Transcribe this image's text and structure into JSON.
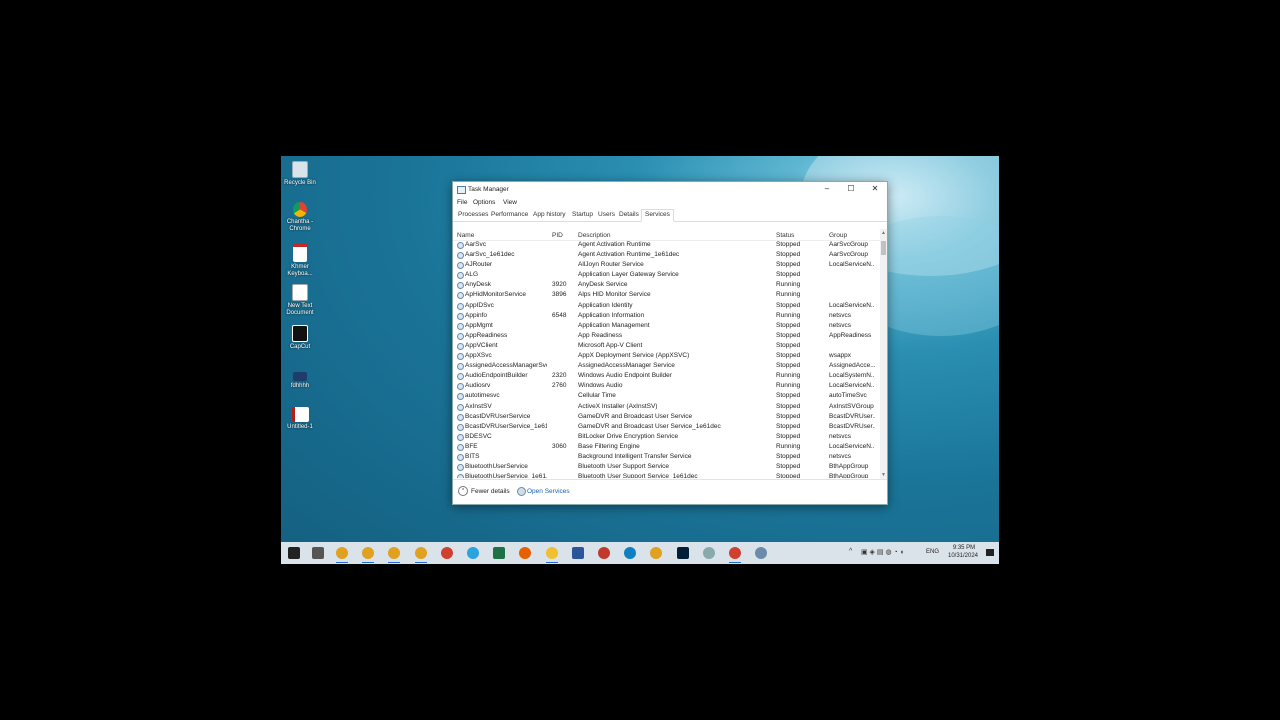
{
  "desktop": {
    "icons": [
      {
        "label": "Recycle Bin",
        "icon": "recycle-bin-icon"
      },
      {
        "label": "Chantha - Chrome",
        "icon": "chrome-icon"
      },
      {
        "label": "Khmer Keyboa...",
        "icon": "pdf-icon"
      },
      {
        "label": "New Text Document",
        "icon": "text-document-icon"
      },
      {
        "label": "CapCut",
        "icon": "capcut-icon"
      },
      {
        "label": "fdhhhh",
        "icon": "shortcut-icon"
      },
      {
        "label": "Untitled-1",
        "icon": "document-icon"
      }
    ]
  },
  "window": {
    "title": "Task Manager",
    "menu": [
      "File",
      "Options",
      "View"
    ],
    "tabs": [
      "Processes",
      "Performance",
      "App history",
      "Startup",
      "Users",
      "Details",
      "Services"
    ],
    "active_tab": "Services"
  },
  "table": {
    "columns": [
      "Name",
      "PID",
      "Description",
      "Status",
      "Group"
    ],
    "rows": [
      [
        "AarSvc",
        "",
        "Agent Activation Runtime",
        "Stopped",
        "AarSvcGroup"
      ],
      [
        "AarSvc_1e61dec",
        "",
        "Agent Activation Runtime_1e61dec",
        "Stopped",
        "AarSvcGroup"
      ],
      [
        "AJRouter",
        "",
        "AllJoyn Router Service",
        "Stopped",
        "LocalServiceN..."
      ],
      [
        "ALG",
        "",
        "Application Layer Gateway Service",
        "Stopped",
        ""
      ],
      [
        "AnyDesk",
        "3920",
        "AnyDesk Service",
        "Running",
        ""
      ],
      [
        "ApHidMonitorService",
        "3896",
        "Alps HID Monitor Service",
        "Running",
        ""
      ],
      [
        "AppIDSvc",
        "",
        "Application Identity",
        "Stopped",
        "LocalServiceN..."
      ],
      [
        "Appinfo",
        "6548",
        "Application Information",
        "Running",
        "netsvcs"
      ],
      [
        "AppMgmt",
        "",
        "Application Management",
        "Stopped",
        "netsvcs"
      ],
      [
        "AppReadiness",
        "",
        "App Readiness",
        "Stopped",
        "AppReadiness"
      ],
      [
        "AppVClient",
        "",
        "Microsoft App-V Client",
        "Stopped",
        ""
      ],
      [
        "AppXSvc",
        "",
        "AppX Deployment Service (AppXSVC)",
        "Stopped",
        "wsappx"
      ],
      [
        "AssignedAccessManagerSvc",
        "",
        "AssignedAccessManager Service",
        "Stopped",
        "AssignedAcce..."
      ],
      [
        "AudioEndpointBuilder",
        "2320",
        "Windows Audio Endpoint Builder",
        "Running",
        "LocalSystemN..."
      ],
      [
        "Audiosrv",
        "2760",
        "Windows Audio",
        "Running",
        "LocalServiceN..."
      ],
      [
        "autotimesvc",
        "",
        "Cellular Time",
        "Stopped",
        "autoTimeSvc"
      ],
      [
        "AxInstSV",
        "",
        "ActiveX Installer (AxInstSV)",
        "Stopped",
        "AxInstSVGroup"
      ],
      [
        "BcastDVRUserService",
        "",
        "GameDVR and Broadcast User Service",
        "Stopped",
        "BcastDVRUser..."
      ],
      [
        "BcastDVRUserService_1e61...",
        "",
        "GameDVR and Broadcast User Service_1e61dec",
        "Stopped",
        "BcastDVRUser..."
      ],
      [
        "BDESVC",
        "",
        "BitLocker Drive Encryption Service",
        "Stopped",
        "netsvcs"
      ],
      [
        "BFE",
        "3060",
        "Base Filtering Engine",
        "Running",
        "LocalServiceN..."
      ],
      [
        "BITS",
        "",
        "Background Intelligent Transfer Service",
        "Stopped",
        "netsvcs"
      ],
      [
        "BluetoothUserService",
        "",
        "Bluetooth User Support Service",
        "Stopped",
        "BthAppGroup"
      ],
      [
        "BluetoothUserService_1e61...",
        "",
        "Bluetooth User Support Service_1e61dec",
        "Stopped",
        "BthAppGroup"
      ]
    ]
  },
  "footer": {
    "fewer_details": "Fewer details",
    "open_services": "Open Services"
  },
  "taskbar": {
    "time": "9:35 PM",
    "date": "10/31/2024",
    "lang": "ENG",
    "apps": [
      "start-icon",
      "task-view-icon",
      "chrome-icon",
      "chrome-icon",
      "chrome-icon",
      "chrome-icon",
      "app-icon",
      "telegram-icon",
      "excel-icon",
      "firefox-icon",
      "file-explorer-icon",
      "word-icon",
      "video-icon",
      "edge-icon",
      "chrome-icon",
      "photoshop-icon",
      "snipping-icon",
      "app-icon",
      "task-manager-icon"
    ]
  }
}
